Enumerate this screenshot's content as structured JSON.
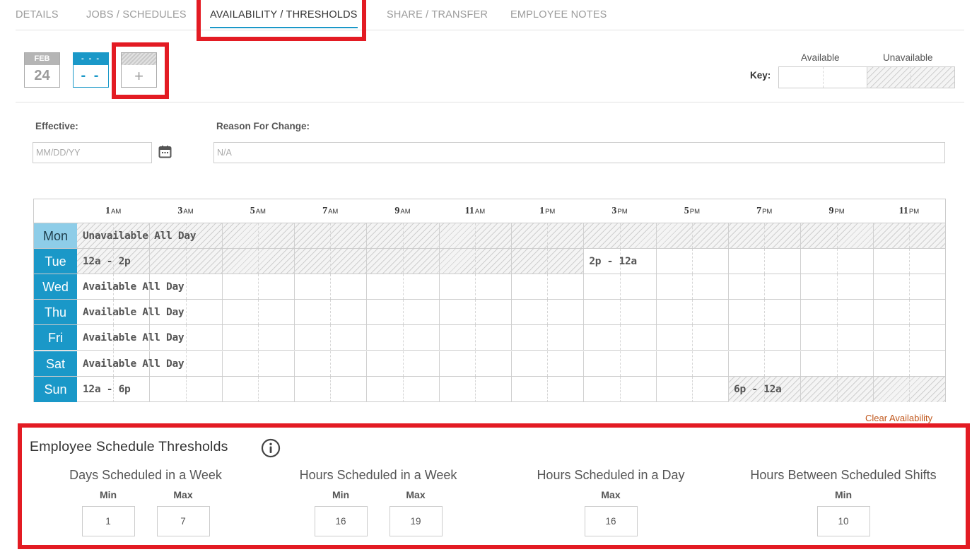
{
  "tabs": [
    {
      "label": "DETAILS"
    },
    {
      "label": "JOBS / SCHEDULES"
    },
    {
      "label": "AVAILABILITY / THRESHOLDS",
      "active": true
    },
    {
      "label": "SHARE / TRANSFER"
    },
    {
      "label": "EMPLOYEE NOTES"
    }
  ],
  "date_chips": [
    {
      "top": "FEB",
      "bottom": "24"
    },
    {
      "top": "- - -",
      "bottom": "- -"
    },
    {
      "top": "",
      "bottom": "+"
    }
  ],
  "key": {
    "label": "Key:",
    "available": "Available",
    "unavailable": "Unavailable"
  },
  "form": {
    "effective_label": "Effective:",
    "effective_placeholder": "MM/DD/YY",
    "reason_label": "Reason For Change:",
    "reason_placeholder": "N/A"
  },
  "grid": {
    "hours": [
      {
        "n": "1",
        "ap": "AM"
      },
      {
        "n": "3",
        "ap": "AM"
      },
      {
        "n": "5",
        "ap": "AM"
      },
      {
        "n": "7",
        "ap": "AM"
      },
      {
        "n": "9",
        "ap": "AM"
      },
      {
        "n": "11",
        "ap": "AM"
      },
      {
        "n": "1",
        "ap": "PM"
      },
      {
        "n": "3",
        "ap": "PM"
      },
      {
        "n": "5",
        "ap": "PM"
      },
      {
        "n": "7",
        "ap": "PM"
      },
      {
        "n": "9",
        "ap": "PM"
      },
      {
        "n": "11",
        "ap": "PM"
      }
    ],
    "days": [
      {
        "day": "Mon",
        "selected": true,
        "segments": [
          {
            "start": 0,
            "end": 24,
            "available": false,
            "label": "Unavailable All Day"
          }
        ]
      },
      {
        "day": "Tue",
        "segments": [
          {
            "start": 0,
            "end": 14,
            "available": false,
            "label": "12a - 2p"
          },
          {
            "start": 14,
            "end": 24,
            "available": true,
            "label": "2p - 12a"
          }
        ]
      },
      {
        "day": "Wed",
        "segments": [
          {
            "start": 0,
            "end": 24,
            "available": true,
            "label": "Available All Day"
          }
        ]
      },
      {
        "day": "Thu",
        "segments": [
          {
            "start": 0,
            "end": 24,
            "available": true,
            "label": "Available All Day"
          }
        ]
      },
      {
        "day": "Fri",
        "segments": [
          {
            "start": 0,
            "end": 24,
            "available": true,
            "label": "Available All Day"
          }
        ]
      },
      {
        "day": "Sat",
        "segments": [
          {
            "start": 0,
            "end": 24,
            "available": true,
            "label": "Available All Day"
          }
        ]
      },
      {
        "day": "Sun",
        "segments": [
          {
            "start": 0,
            "end": 18,
            "available": true,
            "label": "12a - 6p"
          },
          {
            "start": 18,
            "end": 24,
            "available": false,
            "label": "6p - 12a"
          }
        ]
      }
    ]
  },
  "clear_availability": "Clear Availability",
  "thresholds": {
    "title": "Employee Schedule Thresholds",
    "groups": [
      {
        "title": "Days Scheduled in a Week",
        "fields": [
          {
            "label": "Min",
            "value": "1"
          },
          {
            "label": "Max",
            "value": "7"
          }
        ]
      },
      {
        "title": "Hours Scheduled in a Week",
        "fields": [
          {
            "label": "Min",
            "value": "16"
          },
          {
            "label": "Max",
            "value": "19"
          }
        ]
      },
      {
        "title": "Hours Scheduled in a Day",
        "fields": [
          {
            "label": "Max",
            "value": "16"
          }
        ]
      },
      {
        "title": "Hours Between Scheduled Shifts",
        "fields": [
          {
            "label": "Min",
            "value": "10"
          }
        ]
      }
    ]
  },
  "colors": {
    "accent": "#1a98c8",
    "selected_day": "#8ecde8",
    "highlight": "#e31b23",
    "link": "#c0561b"
  }
}
